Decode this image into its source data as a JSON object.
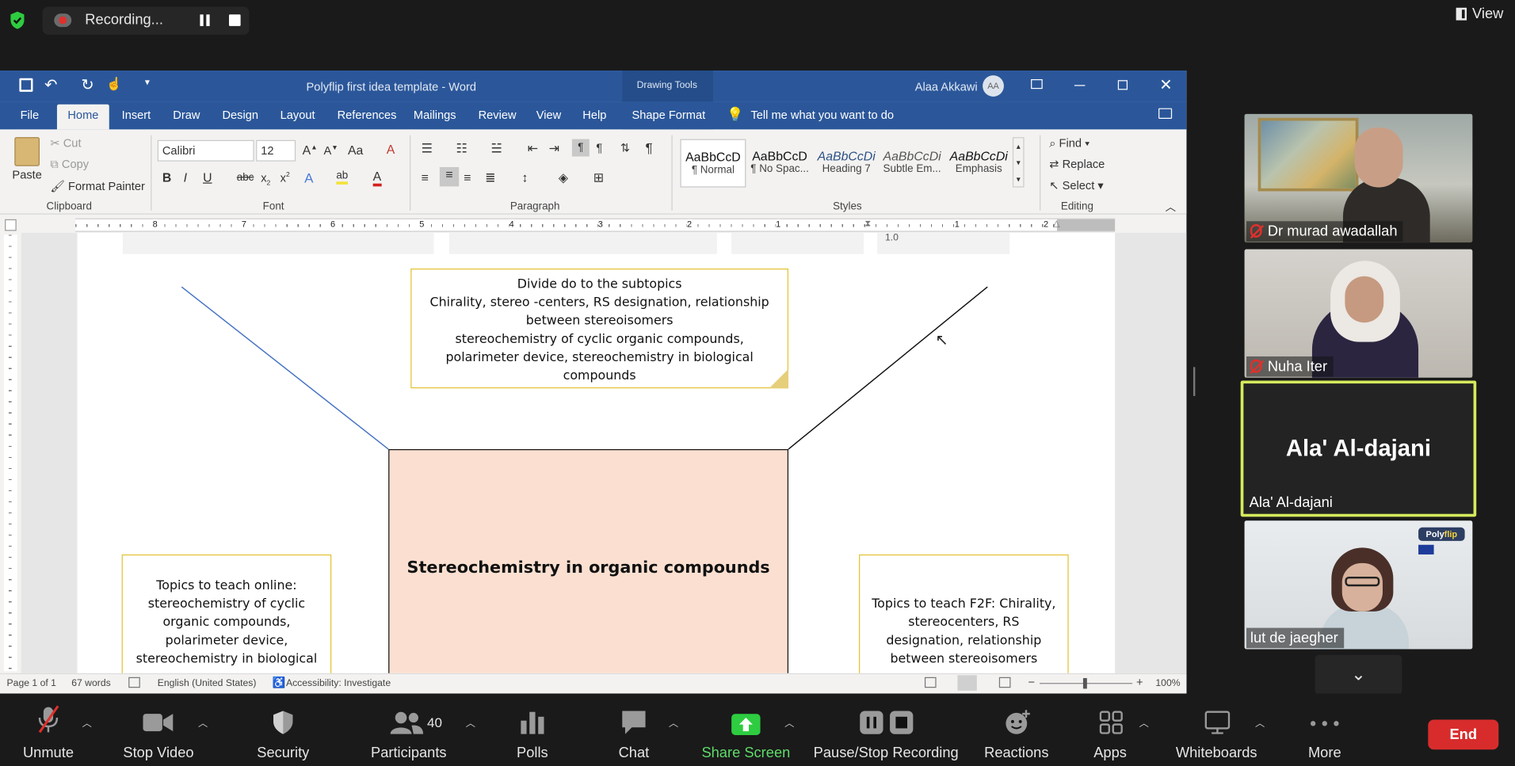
{
  "zoom": {
    "recording_label": "Recording...",
    "view_label": "View",
    "end_label": "End",
    "toolbar": {
      "unmute": "Unmute",
      "stop_video": "Stop Video",
      "security": "Security",
      "participants": "Participants",
      "participants_count": "40",
      "polls": "Polls",
      "chat": "Chat",
      "share_screen": "Share Screen",
      "pause_stop_recording": "Pause/Stop Recording",
      "reactions": "Reactions",
      "apps": "Apps",
      "whiteboards": "Whiteboards",
      "more": "More"
    },
    "participants": [
      {
        "name": "Dr murad awadallah",
        "muted": true
      },
      {
        "name": "Nuha Iter",
        "muted": true
      },
      {
        "name": "Ala' Al-dajani",
        "big_name": "Ala' Al-dajani",
        "muted": false,
        "active_speaker": true
      },
      {
        "name": "lut de jaegher",
        "muted": false,
        "badge": "PolyFlip"
      }
    ],
    "accent_green": "#c8e04a",
    "share_green": "#2ecc40",
    "end_red": "#d82c2c"
  },
  "word": {
    "title": "Polyflip first idea template  -  Word",
    "drawing_tools": "Drawing Tools",
    "user_name": "Alaa Akkawi",
    "user_initials": "AA",
    "tabs": [
      "File",
      "Home",
      "Insert",
      "Draw",
      "Design",
      "Layout",
      "References",
      "Mailings",
      "Review",
      "View",
      "Help",
      "Shape Format"
    ],
    "tell_me": "Tell me what you want to do",
    "clipboard": {
      "paste": "Paste",
      "cut": "Cut",
      "copy": "Copy",
      "format_painter": "Format Painter",
      "label": "Clipboard"
    },
    "font": {
      "name": "Calibri",
      "size": "12",
      "label": "Font"
    },
    "paragraph_label": "Paragraph",
    "styles": [
      {
        "preview": "AaBbCcD",
        "name": "¶ Normal"
      },
      {
        "preview": "AaBbCcD",
        "name": "¶ No Spac..."
      },
      {
        "preview": "AaBbCcDi",
        "name": "Heading 7"
      },
      {
        "preview": "AaBbCcDi",
        "name": "Subtle Em..."
      },
      {
        "preview": "AaBbCcDi",
        "name": "Emphasis"
      }
    ],
    "styles_label": "Styles",
    "editing": {
      "find": "Find",
      "replace": "Replace",
      "select": "Select",
      "label": "Editing"
    },
    "ruler_numbers": [
      "8",
      "7",
      "6",
      "5",
      "4",
      "3",
      "2",
      "1",
      "1",
      "2"
    ],
    "table_fragment": "1.0",
    "document": {
      "top_box": {
        "line1": "Divide do to the subtopics",
        "line2": "Chirality, stereo -centers, RS designation, relationship between stereoisomers",
        "line3": "stereochemistry of cyclic organic compounds, polarimeter device, stereochemistry in biological compounds"
      },
      "center_title": "Stereochemistry in organic compounds",
      "left_box": "Topics to teach online: stereochemistry of cyclic organic compounds, polarimeter device, stereochemistry in biological",
      "right_box": "Topics to teach F2F: Chirality, stereocenters, RS designation, relationship between stereoisomers"
    },
    "status": {
      "page": "Page 1 of 1",
      "words": "67 words",
      "language": "English (United States)",
      "accessibility": "Accessibility: Investigate",
      "zoom": "100%"
    },
    "brand_blue": "#2b579a"
  }
}
